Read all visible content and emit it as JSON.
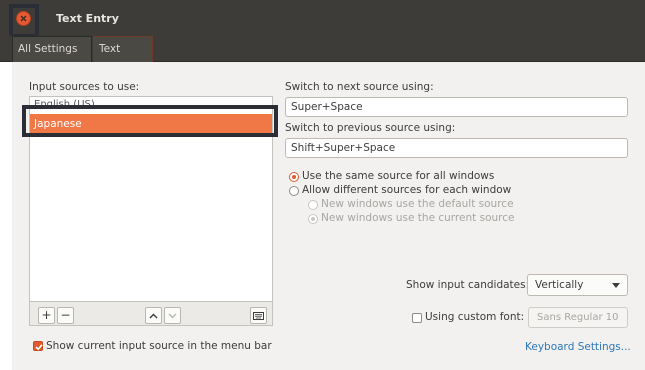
{
  "window": {
    "title": "Text Entry"
  },
  "breadcrumb": {
    "all": "All Settings",
    "current": "Text Entry"
  },
  "sources": {
    "heading": "Input sources to use:",
    "items": [
      "English (US)",
      "Japanese"
    ],
    "selected": "Japanese"
  },
  "toolbar": {
    "add": "+",
    "remove": "−",
    "up": "^",
    "down": "v"
  },
  "shortcuts": {
    "next_label": "Switch to next source using:",
    "next_value": "Super+Space",
    "prev_label": "Switch to previous source using:",
    "prev_value": "Shift+Super+Space"
  },
  "options": {
    "same_source": "Use the same source for all windows",
    "different_sources": "Allow different sources for each window",
    "new_default": "New windows use the default source",
    "new_current": "New windows use the current source"
  },
  "candidates": {
    "label": "Show input candidates:",
    "value": "Vertically"
  },
  "custom_font": {
    "label": "Using custom font:",
    "value": "Sans Regular  10"
  },
  "menubar": {
    "label": "Show current input source in the menu bar"
  },
  "keyboard_link": "Keyboard Settings...",
  "colors": {
    "accent": "#f07746",
    "titlebar": "#3d3c38",
    "link": "#2f76b8"
  }
}
